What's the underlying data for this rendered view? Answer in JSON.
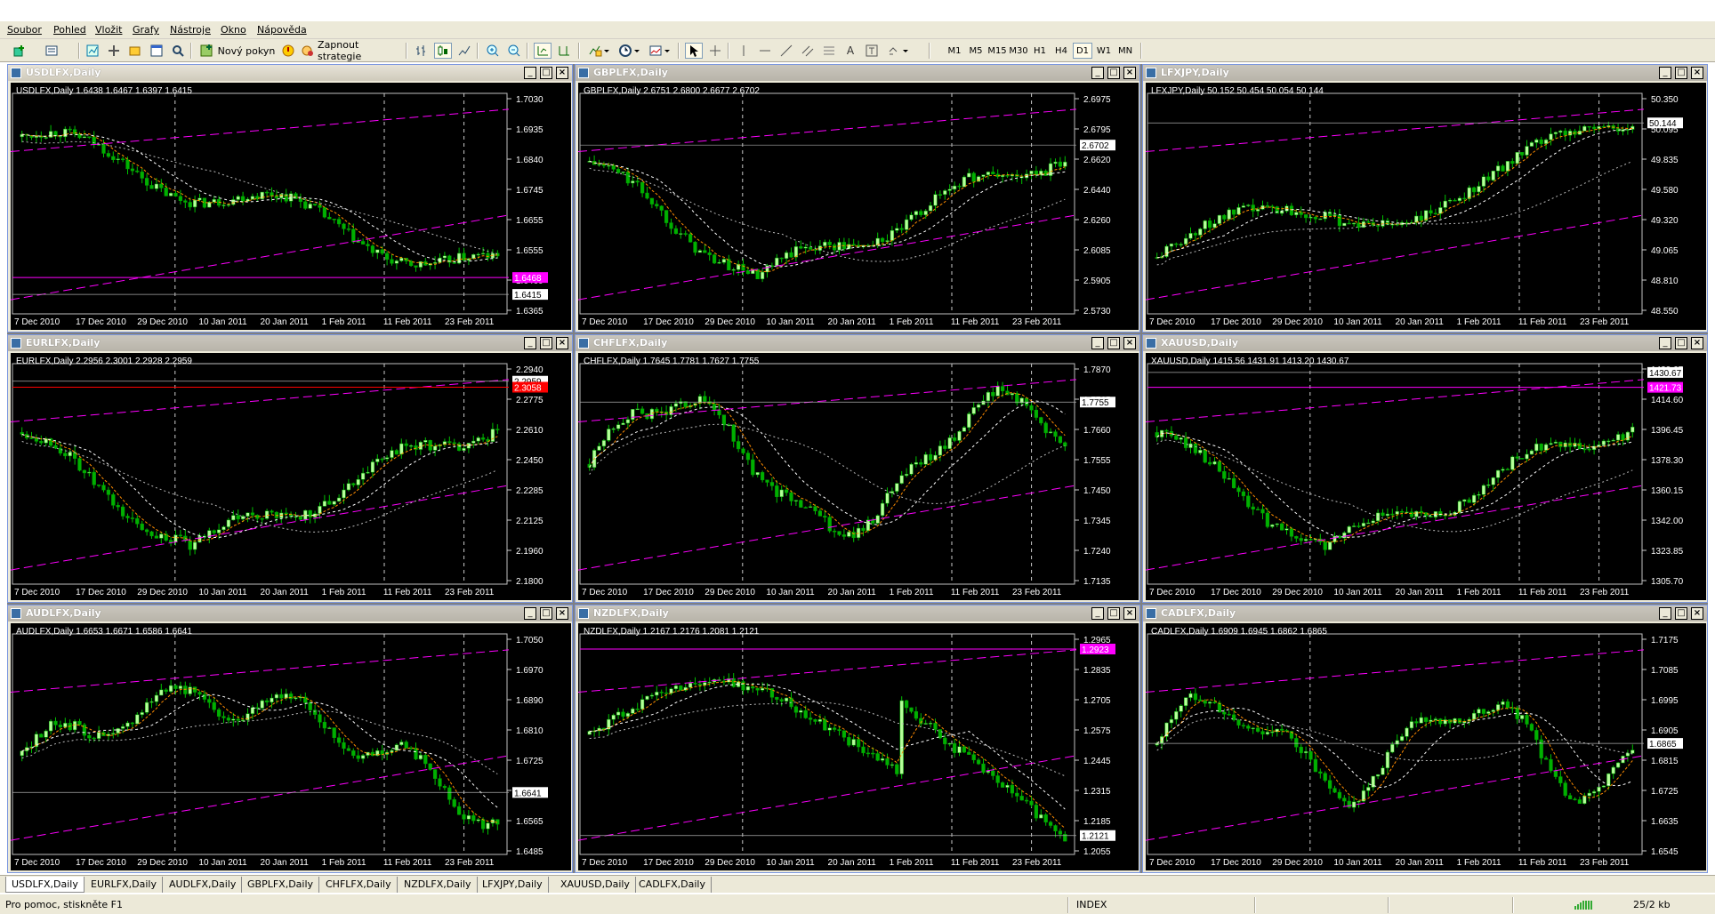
{
  "menu": [
    "Soubor",
    "Pohled",
    "Vložit",
    "Grafy",
    "Nástroje",
    "Okno",
    "Nápověda"
  ],
  "toolbar": {
    "new_order": "Nový pokyn",
    "strategies": "Zapnout strategie",
    "timeframes": [
      "M1",
      "M5",
      "M15",
      "M30",
      "H1",
      "H4",
      "D1",
      "W1",
      "MN"
    ],
    "active_timeframe": "D1",
    "text_tool": "A"
  },
  "date_labels": [
    "7 Dec 2010",
    "17 Dec 2010",
    "29 Dec 2010",
    "10 Jan 2011",
    "20 Jan 2011",
    "1 Feb 2011",
    "11 Feb 2011",
    "23 Feb 2011"
  ],
  "colors": {
    "bull": "#b6ff9a",
    "bear": "#00b000",
    "trend": "#ff00ff",
    "ma_fast": "#ff8c00",
    "ma_slow": "#ffffff",
    "red": "#ff0000"
  },
  "charts": [
    {
      "title": "USDLFX,Daily",
      "info": "USDLFX,Daily  1.6438 1.6467 1.6397 1.6415",
      "ticks": [
        "1.7030",
        "1.6935",
        "1.6840",
        "1.6745",
        "1.6655",
        "1.6555",
        "1.6460",
        "1.6365"
      ],
      "price_tag": "1.6415",
      "alt_tag": "1.6468",
      "min": 1.6365,
      "max": 1.703,
      "last": 1.6415,
      "alt": 1.6468,
      "shape": "down"
    },
    {
      "title": "GBPLFX,Daily",
      "info": "GBPLFX,Daily  2.6751 2.6800 2.6677 2.6702",
      "ticks": [
        "2.6975",
        "2.6795",
        "2.6620",
        "2.6440",
        "2.6260",
        "2.6085",
        "2.5905",
        "2.5730"
      ],
      "price_tag": "2.6702",
      "alt_tag": "",
      "min": 2.573,
      "max": 2.6975,
      "last": 2.6702,
      "alt": null,
      "shape": "vup"
    },
    {
      "title": "LFXJPY,Daily",
      "info": "LFXJPY,Daily  50.152 50.454 50.054 50.144",
      "ticks": [
        "50.350",
        "50.095",
        "49.835",
        "49.580",
        "49.320",
        "49.065",
        "48.810",
        "48.550"
      ],
      "price_tag": "50.144",
      "alt_tag": "",
      "min": 48.55,
      "max": 50.35,
      "last": 50.144,
      "alt": null,
      "shape": "up"
    },
    {
      "title": "EURLFX,Daily",
      "info": "EURLFX,Daily  2.2956 2.3001 2.2928 2.2959",
      "ticks": [
        "2.2940",
        "2.2775",
        "2.2610",
        "2.2450",
        "2.2285",
        "2.2125",
        "2.1960",
        "2.1800"
      ],
      "price_tag": "2.2959",
      "alt_tag": "2.3058",
      "min": 2.18,
      "max": 2.303,
      "last": 2.2959,
      "alt": 2.2924,
      "shape": "vup"
    },
    {
      "title": "CHFLFX,Daily",
      "info": "CHFLFX,Daily  1.7645 1.7781 1.7627 1.7755",
      "ticks": [
        "1.7870",
        "1.7765",
        "1.7660",
        "1.7555",
        "1.7450",
        "1.7345",
        "1.7240",
        "1.7135"
      ],
      "price_tag": "1.7755",
      "alt_tag": "",
      "min": 1.7135,
      "max": 1.787,
      "last": 1.7755,
      "alt": null,
      "shape": "wave"
    },
    {
      "title": "XAUUSD,Daily",
      "info": "XAUUSD,Daily  1415.56 1431.91 1413.20 1430.67",
      "ticks": [
        "1430.67",
        "1414.60",
        "1396.45",
        "1378.30",
        "1360.15",
        "1342.00",
        "1323.85",
        "1305.70"
      ],
      "price_tag": "1430.67",
      "alt_tag": "1421.73",
      "min": 1305.7,
      "max": 1432.75,
      "last": 1430.67,
      "alt": 1421.73,
      "shape": "vup"
    },
    {
      "title": "AUDLFX,Daily",
      "info": "AUDLFX,Daily  1.6653 1.6671 1.6586 1.6641",
      "ticks": [
        "1.7050",
        "1.6970",
        "1.6890",
        "1.6810",
        "1.6725",
        "1.6645",
        "1.6565",
        "1.6485"
      ],
      "price_tag": "1.6641",
      "alt_tag": "",
      "min": 1.6485,
      "max": 1.705,
      "last": 1.6641,
      "alt": null,
      "shape": "hump"
    },
    {
      "title": "NZDLFX,Daily",
      "info": "NZDLFX,Daily  1.2167 1.2176 1.2081 1.2121",
      "ticks": [
        "1.2965",
        "1.2835",
        "1.2705",
        "1.2575",
        "1.2445",
        "1.2315",
        "1.2185",
        "1.2055"
      ],
      "price_tag": "1.2121",
      "alt_tag": "1.2923",
      "min": 1.2055,
      "max": 1.2965,
      "last": 1.2121,
      "alt": 1.2923,
      "shape": "downlate"
    },
    {
      "title": "CADLFX,Daily",
      "info": "CADLFX,Daily  1.6909 1.6945 1.6862 1.6865",
      "ticks": [
        "1.7175",
        "1.7085",
        "1.6995",
        "1.6905",
        "1.6815",
        "1.6725",
        "1.6635",
        "1.6545"
      ],
      "price_tag": "1.6865",
      "alt_tag": "",
      "min": 1.6545,
      "max": 1.7175,
      "last": 1.6865,
      "alt": null,
      "shape": "range"
    }
  ],
  "tabs": [
    "USDLFX,Daily",
    "EURLFX,Daily",
    "AUDLFX,Daily",
    "GBPLFX,Daily",
    "CHFLFX,Daily",
    "NZDLFX,Daily",
    "LFXJPY,Daily",
    "XAUUSD,Daily",
    "CADLFX,Daily"
  ],
  "active_tab": 0,
  "status": {
    "help": "Pro pomoc, stiskněte F1",
    "profile": "INDEX",
    "traffic": "25/2 kb"
  }
}
